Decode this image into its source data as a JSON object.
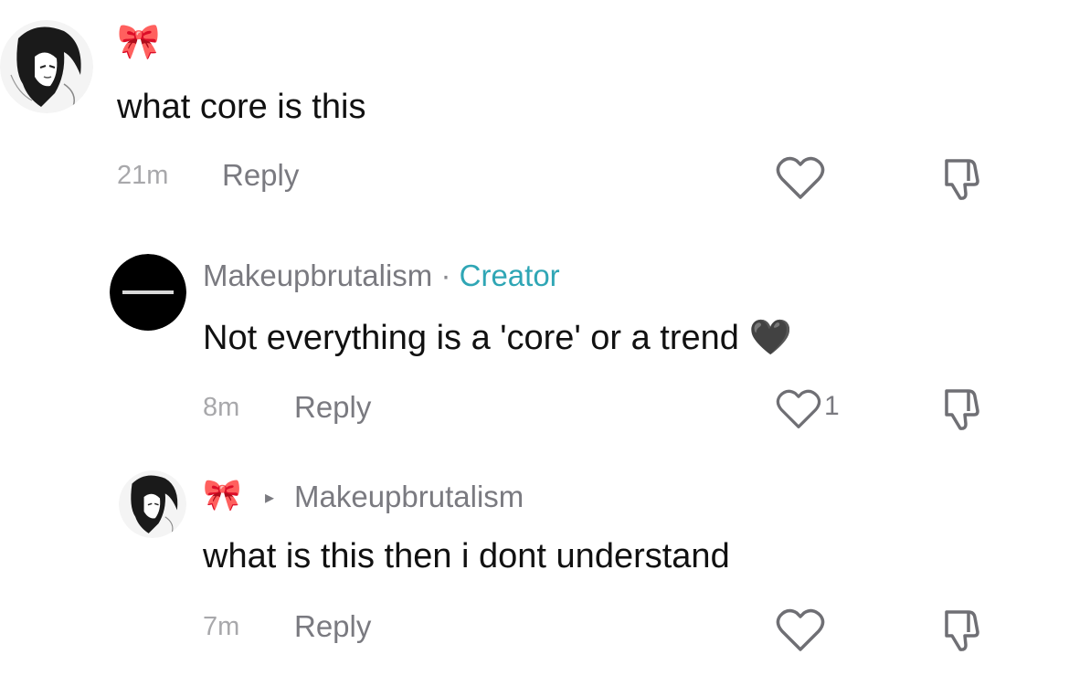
{
  "comments": [
    {
      "username_emoji": "🎀",
      "text": "what core is this",
      "time": "21m",
      "reply_label": "Reply",
      "avatar": "anime-sketch-avatar",
      "like_icon": "heart-outline-icon",
      "dislike_icon": "thumbs-down-icon"
    },
    {
      "username": "Makeupbrutalism",
      "separator": "·",
      "badge": "Creator",
      "text": "Not everything is a 'core' or a trend",
      "text_emoji": "🖤",
      "time": "8m",
      "reply_label": "Reply",
      "like_count": "1",
      "avatar": "black-circle-logo-avatar",
      "like_icon": "heart-outline-icon",
      "dislike_icon": "thumbs-down-icon"
    },
    {
      "username_emoji": "🎀",
      "reply_arrow": "▸",
      "reply_to": "Makeupbrutalism",
      "text": "what is this then i dont understand",
      "time": "7m",
      "reply_label": "Reply",
      "avatar": "anime-sketch-avatar",
      "like_icon": "heart-outline-icon",
      "dislike_icon": "thumbs-down-icon"
    }
  ],
  "colors": {
    "creator_badge": "#2fa6b5",
    "meta_gray": "#7a7a80",
    "bow_pink": "#f2a3b5"
  }
}
